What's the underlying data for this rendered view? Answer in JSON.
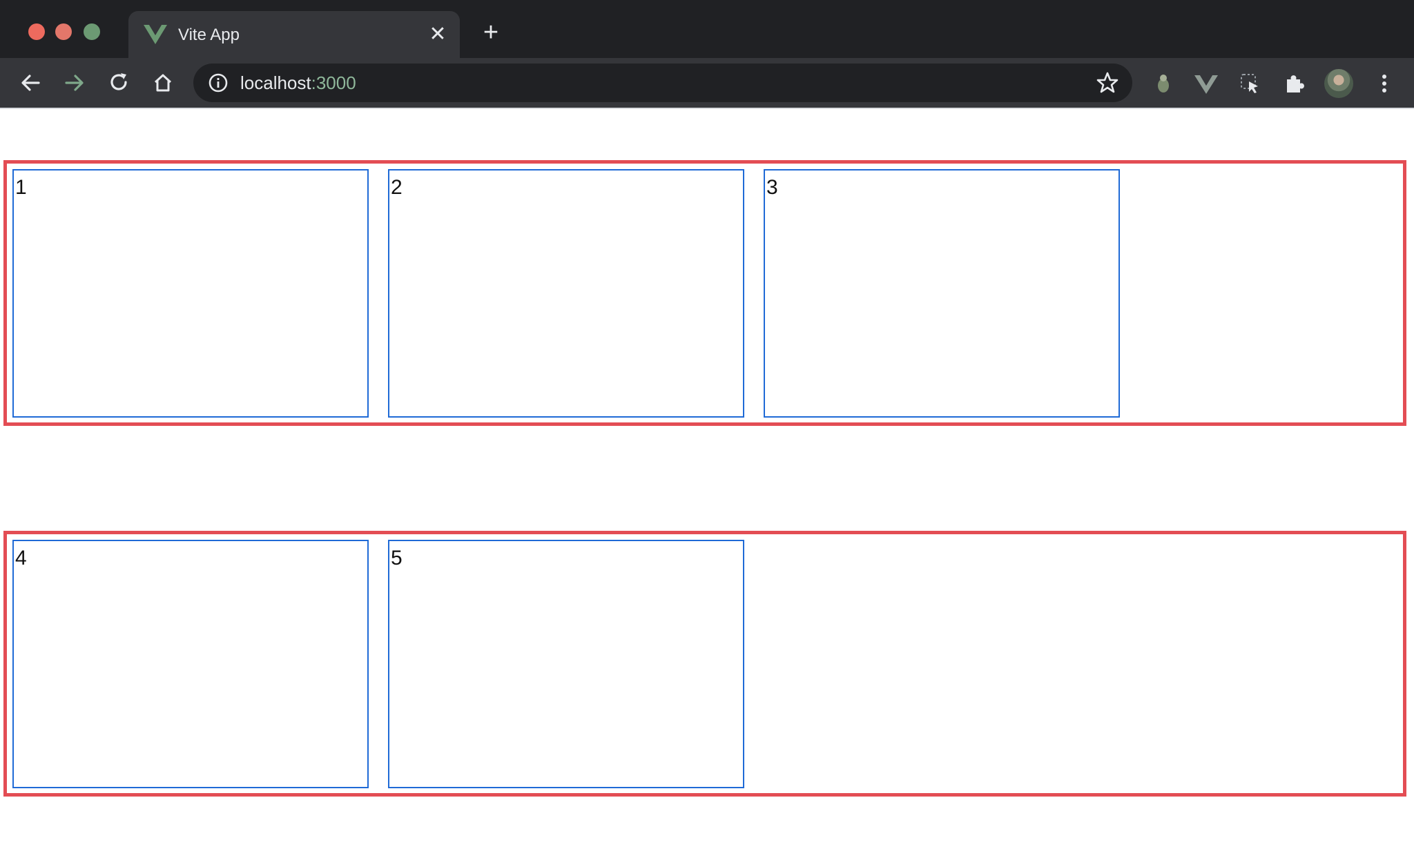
{
  "browser": {
    "tab": {
      "title": "Vite App",
      "close_symbol": "✕"
    },
    "new_tab_symbol": "+",
    "address_bar": {
      "host": "localhost",
      "port": ":3000"
    },
    "colors": {
      "vue_green": "#41b883",
      "row_border": "#e34d54",
      "card_border": "#1f6ad6"
    }
  },
  "content": {
    "rows": [
      {
        "cards": [
          {
            "label": "1"
          },
          {
            "label": "2"
          },
          {
            "label": "3"
          }
        ]
      },
      {
        "cards": [
          {
            "label": "4"
          },
          {
            "label": "5"
          }
        ]
      }
    ]
  }
}
